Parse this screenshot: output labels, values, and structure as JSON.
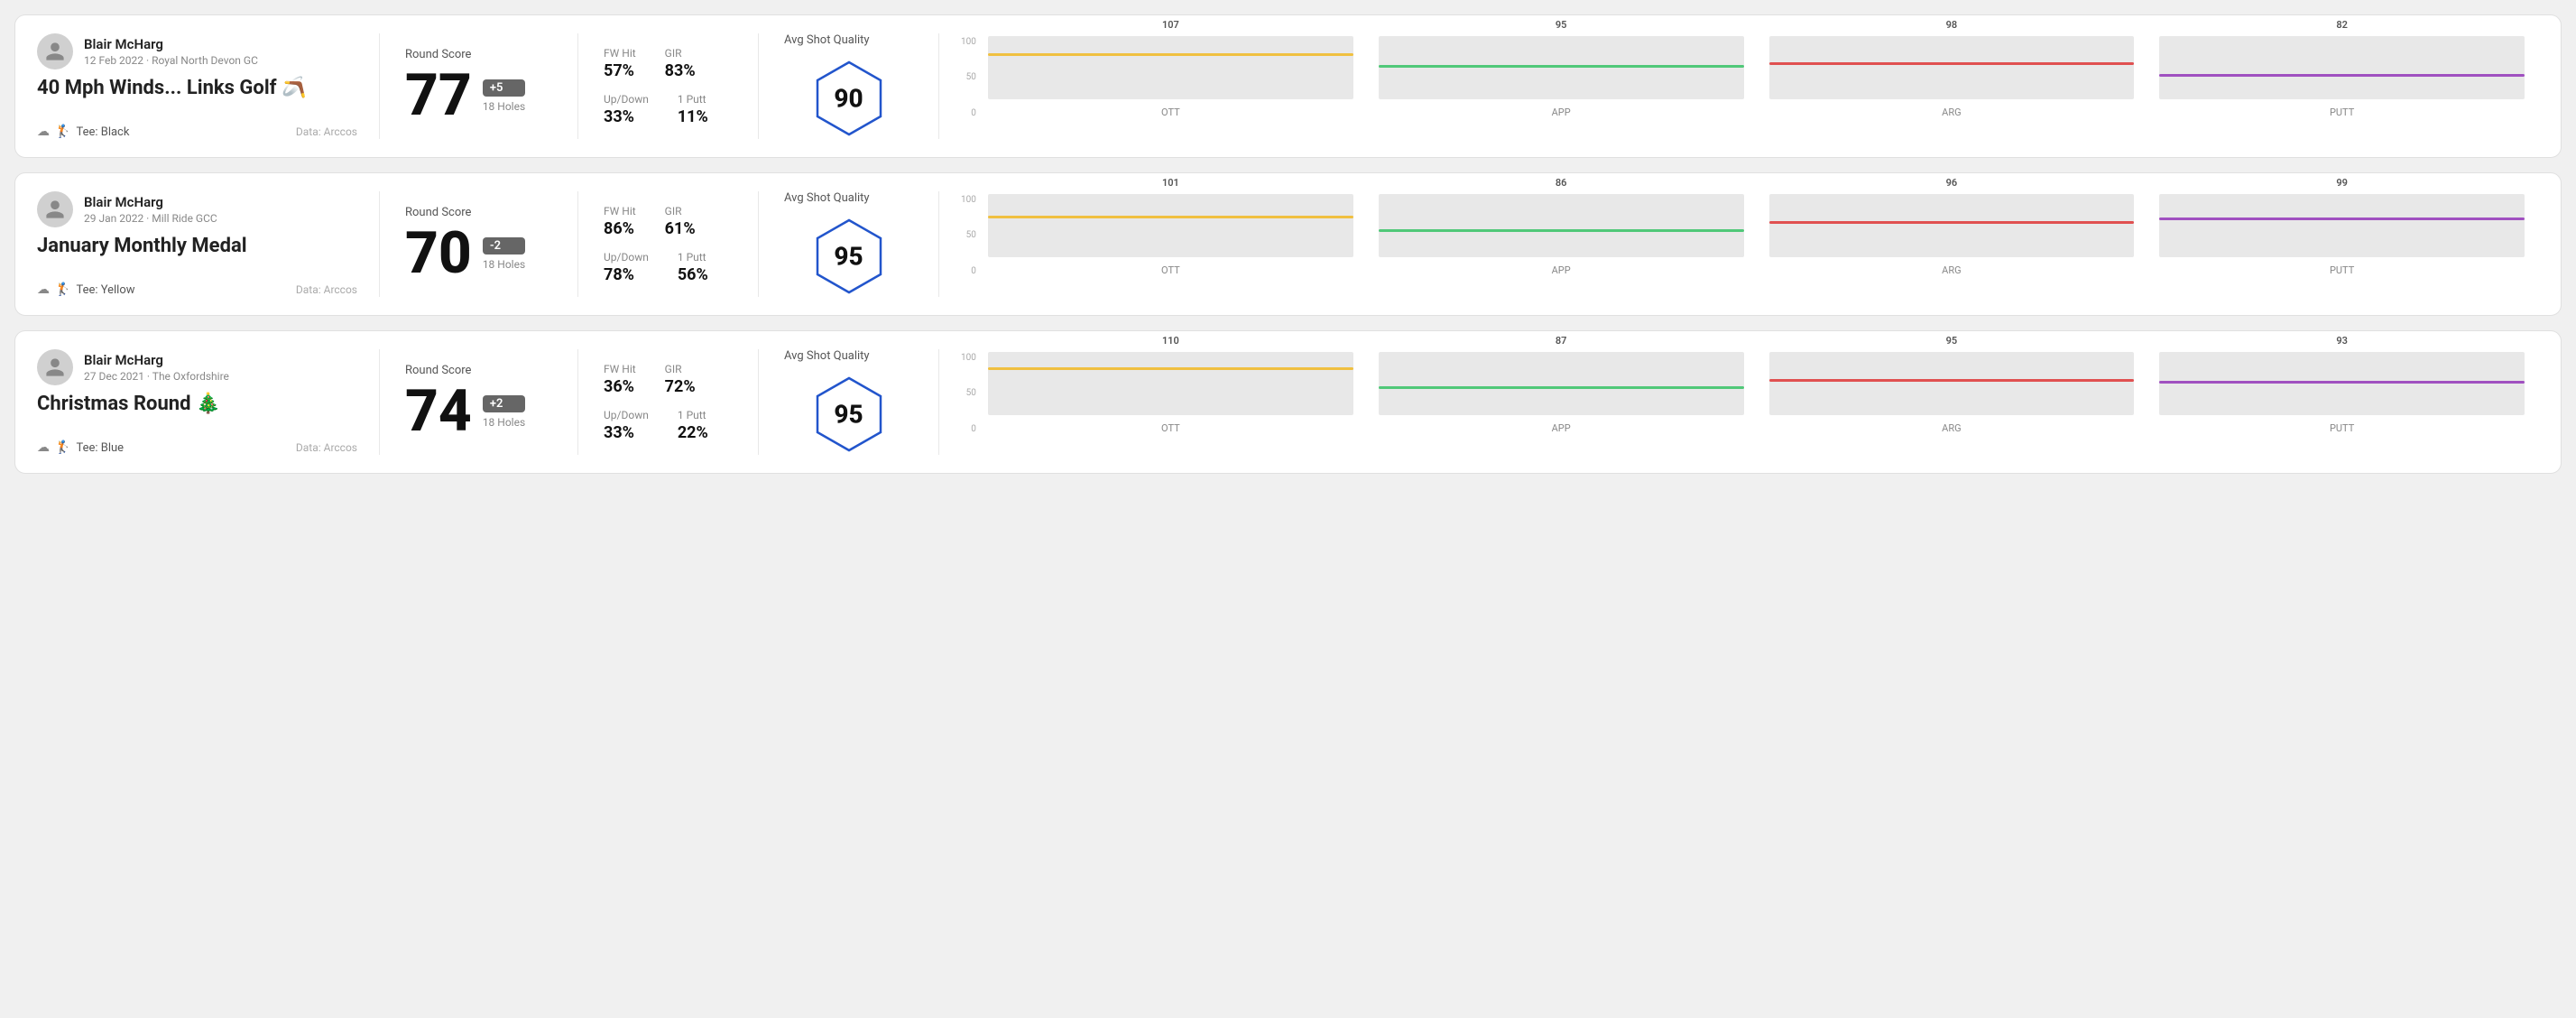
{
  "rounds": [
    {
      "id": "round1",
      "user": {
        "name": "Blair McHarg",
        "date": "12 Feb 2022 · Royal North Devon GC"
      },
      "title": "40 Mph Winds... Links Golf 🪃",
      "tee": "Black",
      "dataSource": "Data: Arccos",
      "score": {
        "value": "77",
        "modifier": "+5",
        "modifierType": "positive",
        "holes": "18 Holes"
      },
      "stats": {
        "fwHit": "57%",
        "gir": "83%",
        "upDown": "33%",
        "onePutt": "11%"
      },
      "shotQuality": "90",
      "chart": {
        "ott": {
          "value": 107,
          "height": 75
        },
        "app": {
          "value": 95,
          "height": 55
        },
        "arg": {
          "value": 98,
          "height": 60
        },
        "putt": {
          "value": 82,
          "height": 40
        }
      }
    },
    {
      "id": "round2",
      "user": {
        "name": "Blair McHarg",
        "date": "29 Jan 2022 · Mill Ride GCC"
      },
      "title": "January Monthly Medal",
      "tee": "Yellow",
      "dataSource": "Data: Arccos",
      "score": {
        "value": "70",
        "modifier": "-2",
        "modifierType": "negative",
        "holes": "18 Holes"
      },
      "stats": {
        "fwHit": "86%",
        "gir": "61%",
        "upDown": "78%",
        "onePutt": "56%"
      },
      "shotQuality": "95",
      "chart": {
        "ott": {
          "value": 101,
          "height": 68
        },
        "app": {
          "value": 86,
          "height": 44
        },
        "arg": {
          "value": 96,
          "height": 58
        },
        "putt": {
          "value": 99,
          "height": 65
        }
      }
    },
    {
      "id": "round3",
      "user": {
        "name": "Blair McHarg",
        "date": "27 Dec 2021 · The Oxfordshire"
      },
      "title": "Christmas Round 🎄",
      "tee": "Blue",
      "dataSource": "Data: Arccos",
      "score": {
        "value": "74",
        "modifier": "+2",
        "modifierType": "positive",
        "holes": "18 Holes"
      },
      "stats": {
        "fwHit": "36%",
        "gir": "72%",
        "upDown": "33%",
        "onePutt": "22%"
      },
      "shotQuality": "95",
      "chart": {
        "ott": {
          "value": 110,
          "height": 78
        },
        "app": {
          "value": 87,
          "height": 46
        },
        "arg": {
          "value": 95,
          "height": 58
        },
        "putt": {
          "value": 93,
          "height": 55
        }
      }
    }
  ],
  "labels": {
    "roundScore": "Round Score",
    "avgShotQuality": "Avg Shot Quality",
    "fwHit": "FW Hit",
    "gir": "GIR",
    "upDown": "Up/Down",
    "onePutt": "1 Putt",
    "ott": "OTT",
    "app": "APP",
    "arg": "ARG",
    "putt": "PUTT",
    "teePrefix": "Tee:",
    "chartY100": "100",
    "chartY50": "50",
    "chartY0": "0"
  }
}
